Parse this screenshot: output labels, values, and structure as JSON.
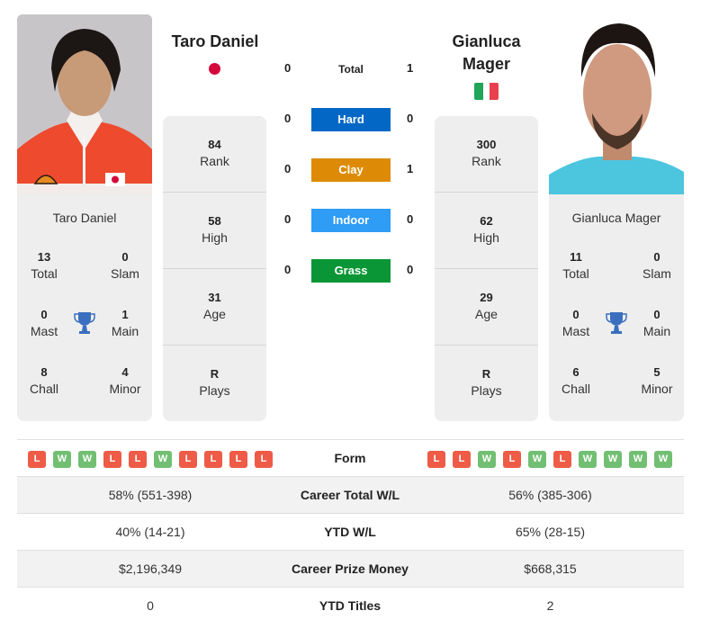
{
  "player_left": {
    "name": "Taro Daniel",
    "country_flag": "japan-flag-icon",
    "rank": "84",
    "rank_label": "Rank",
    "high": "58",
    "high_label": "High",
    "age": "31",
    "age_label": "Age",
    "plays": "R",
    "plays_label": "Plays",
    "titles": {
      "total": "13",
      "total_label": "Total",
      "slam": "0",
      "slam_label": "Slam",
      "mast": "0",
      "mast_label": "Mast",
      "main": "1",
      "main_label": "Main",
      "chall": "8",
      "chall_label": "Chall",
      "minor": "4",
      "minor_label": "Minor"
    },
    "form": [
      "L",
      "W",
      "W",
      "L",
      "L",
      "W",
      "L",
      "L",
      "L",
      "L"
    ]
  },
  "player_right": {
    "name": "Gianluca Mager",
    "country_flag": "italy-flag-icon",
    "rank": "300",
    "rank_label": "Rank",
    "high": "62",
    "high_label": "High",
    "age": "29",
    "age_label": "Age",
    "plays": "R",
    "plays_label": "Plays",
    "titles": {
      "total": "11",
      "total_label": "Total",
      "slam": "0",
      "slam_label": "Slam",
      "mast": "0",
      "mast_label": "Mast",
      "main": "0",
      "main_label": "Main",
      "chall": "6",
      "chall_label": "Chall",
      "minor": "5",
      "minor_label": "Minor"
    },
    "form": [
      "L",
      "L",
      "W",
      "L",
      "W",
      "L",
      "W",
      "W",
      "W",
      "W"
    ]
  },
  "h2h": [
    {
      "label": "Total",
      "left": "0",
      "right": "1",
      "color": ""
    },
    {
      "label": "Hard",
      "left": "0",
      "right": "0",
      "color": "#0368c5"
    },
    {
      "label": "Clay",
      "left": "0",
      "right": "1",
      "color": "#dd8b07"
    },
    {
      "label": "Indoor",
      "left": "0",
      "right": "0",
      "color": "#2f9cf5"
    },
    {
      "label": "Grass",
      "left": "0",
      "right": "0",
      "color": "#0a9636"
    }
  ],
  "comparison": {
    "form_label": "Form",
    "rows": [
      {
        "label": "Career Total W/L",
        "left": "58% (551-398)",
        "right": "56% (385-306)"
      },
      {
        "label": "YTD W/L",
        "left": "40% (14-21)",
        "right": "65% (28-15)"
      },
      {
        "label": "Career Prize Money",
        "left": "$2,196,349",
        "right": "$668,315"
      },
      {
        "label": "YTD Titles",
        "left": "0",
        "right": "2"
      }
    ]
  }
}
